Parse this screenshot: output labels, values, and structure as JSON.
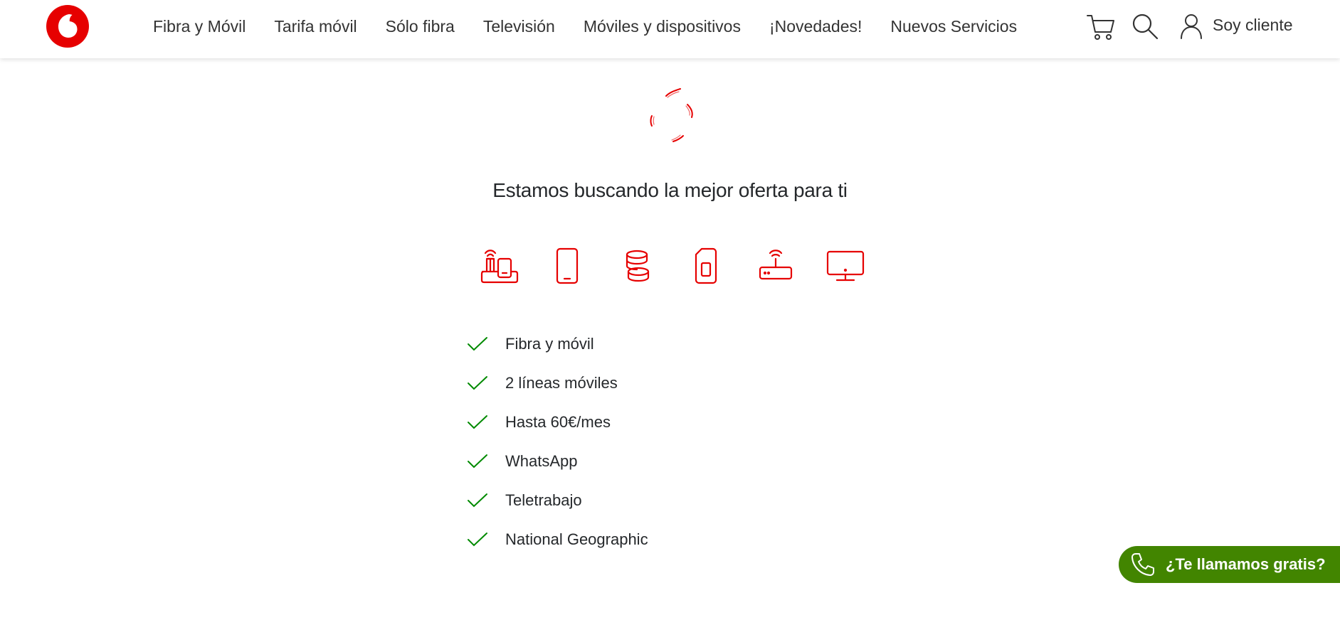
{
  "header": {
    "logo": "vodafone-logo",
    "nav": [
      "Fibra y Móvil",
      "Tarifa móvil",
      "Sólo fibra",
      "Televisión",
      "Móviles y dispositivos",
      "¡Novedades!",
      "Nuevos Servicios"
    ],
    "cart_icon": "cart-icon",
    "search_icon": "search-icon",
    "user_icon": "user-icon",
    "account_label": "Soy cliente"
  },
  "main": {
    "spinner": "loading-spinner-icon",
    "headline": "Estamos buscando la mejor oferta para ti",
    "product_icons": [
      "fiber-phone-icon",
      "mobile-phone-icon",
      "coins-icon",
      "sim-card-icon",
      "router-icon",
      "tv-icon"
    ],
    "checklist": [
      "Fibra y móvil",
      "2 líneas móviles",
      "Hasta 60€/mes",
      "WhatsApp",
      "Teletrabajo",
      "National Geographic"
    ]
  },
  "callback": {
    "label": "¿Te llamamos gratis?",
    "icon": "phone-icon"
  },
  "colors": {
    "brand_red": "#e60000",
    "check_green": "#008a00",
    "callback_green": "#428500",
    "text": "#25282b"
  }
}
